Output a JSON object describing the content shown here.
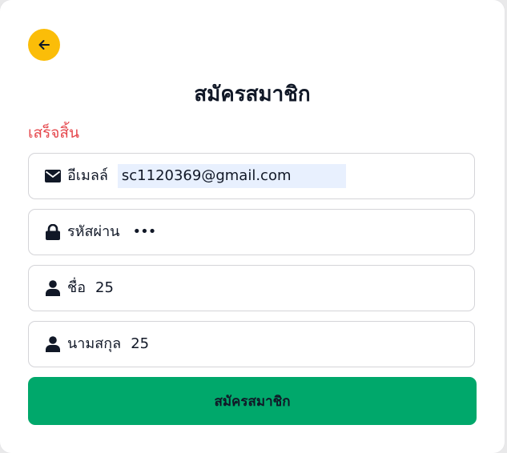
{
  "header": {
    "back_icon": "arrow-left-icon",
    "back_color": "#fbbd08",
    "title": "สมัครสมาชิก"
  },
  "status": {
    "text": "เสร็จสิ้น",
    "color": "#e5484d"
  },
  "form": {
    "email": {
      "icon": "envelope-icon",
      "label": "อีเมลล์",
      "value": "sc1120369@gmail.com"
    },
    "password": {
      "icon": "lock-icon",
      "label": "รหัสผ่าน",
      "value": "•••"
    },
    "first_name": {
      "icon": "user-icon",
      "label": "ชื่อ",
      "value": "25"
    },
    "last_name": {
      "icon": "user-icon",
      "label": "นามสกุล",
      "value": "25"
    }
  },
  "submit": {
    "label": "สมัครสมาชิก",
    "color": "#00a86b"
  }
}
